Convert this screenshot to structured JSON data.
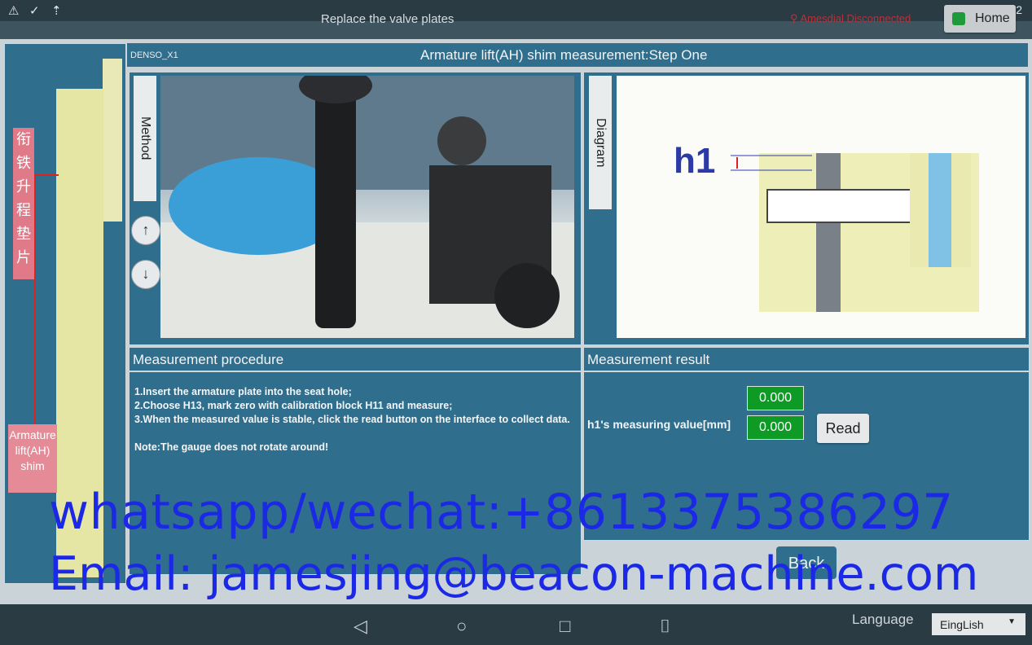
{
  "window": {
    "title": "Replace the valve plates",
    "connection_status": "Amesdial Disconnected",
    "clock": "10:42",
    "home_label": "Home"
  },
  "header": {
    "model": "DENSO_X1",
    "step_title": "Armature lift(AH) shim measurement:Step One"
  },
  "left_panel": {
    "chinese_label": "衔铁升程垫片",
    "english_label": "Armature lift(AH) shim"
  },
  "method": {
    "tab_label": "Method"
  },
  "diagram": {
    "tab_label": "Diagram",
    "marker": "h1"
  },
  "procedure": {
    "heading": "Measurement procedure",
    "text": "1.Insert the armature plate into the seat hole;\n2.Choose H13, mark zero with calibration block H11 and measure;\n3.When the measured value is stable, click the read button on the interface to collect data.\n\nNote:The gauge does not rotate around!"
  },
  "result": {
    "heading": "Measurement result",
    "top_value": "0.000",
    "label": "h1's measuring value[mm]",
    "value": "0.000",
    "read_label": "Read"
  },
  "back_label": "Back",
  "overlay": {
    "contact_line": "whatsapp/wechat:+8613375386297",
    "email_line": "Email: jamesjing@beacon-machine.com"
  },
  "navbar": {
    "language_label": "Language",
    "language_value": "EingLish"
  }
}
